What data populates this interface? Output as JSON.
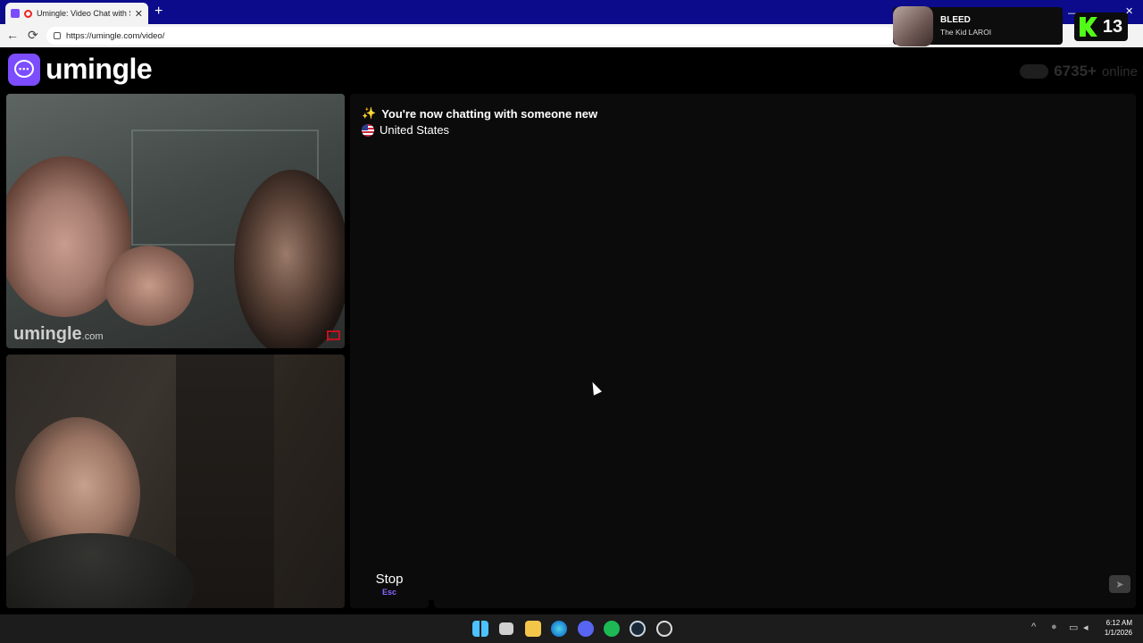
{
  "browser": {
    "tab_title": "Umingle: Video Chat with Stra",
    "tab_close": "✕",
    "new_tab": "+",
    "back": "←",
    "reload": "⟳",
    "url": "https://umingle.com/video/",
    "minimize": "—",
    "maximize": "☐",
    "close": "✕"
  },
  "now_playing": {
    "title": "BLEED",
    "artist": "The Kid LAROI"
  },
  "kick_overlay": {
    "count": "13"
  },
  "site": {
    "logo_text": "umingle",
    "online_count": "6735+",
    "online_label": "online"
  },
  "video": {
    "watermark": "umingle",
    "watermark_suffix": ".com"
  },
  "chat": {
    "status_icon": "✨",
    "status_message": "You're now chatting with someone new",
    "country": "United States"
  },
  "controls": {
    "stop_label": "Stop",
    "stop_shortcut": "Esc",
    "send_icon": "➤"
  },
  "taskbar": {
    "time": "6:12 AM",
    "date": "1/1/2026",
    "apps": [
      "start-icon",
      "task-view-icon",
      "file-explorer-icon",
      "edge-icon",
      "discord-icon",
      "spotify-icon",
      "steam-icon",
      "obs-icon"
    ]
  },
  "colors": {
    "brand": "#7b4dff",
    "tabstrip": "#0b0b8c",
    "kick_green": "#53fc18",
    "report_red": "#c1121f"
  }
}
